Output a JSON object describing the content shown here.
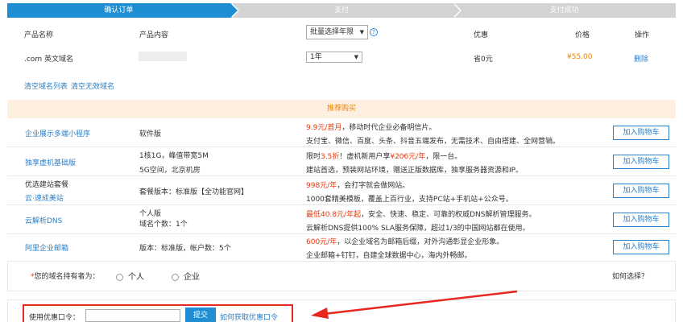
{
  "steps": [
    "确认订单",
    "支付",
    "支付成功"
  ],
  "product_table": {
    "headers": {
      "name": "产品名称",
      "content": "产品内容",
      "discount": "优惠",
      "price": "价格",
      "action": "操作"
    },
    "batch_year_select": "批量选择年限",
    "row": {
      "name": ".com 英文域名",
      "year": "1年",
      "discount": "省0元",
      "price": "¥55.00",
      "delete": "删除"
    }
  },
  "links": {
    "clear_list": "清空域名列表",
    "clear_invalid": "清空无效域名"
  },
  "recommend": {
    "title": "推荐购买",
    "add_to_cart": "加入购物车",
    "items": [
      {
        "name": "企业展示多端小程序",
        "content": [
          "软件版"
        ],
        "desc1_red": "9.9元/首月",
        "desc1_rest": "，移动时代企业必备明信片。",
        "desc2": "支付宝、微信、百度、头条、抖音五端发布，无需技术、自由搭建、全网营销。"
      },
      {
        "name": "独享虚机基础版",
        "content": [
          "1核1G，峰值带宽5M",
          "5G空间，北京机房"
        ],
        "desc1_pre": "限时",
        "desc1_red": "3.5折",
        "desc1_mid": "！虚机新用户享",
        "desc1_red2": "¥206元/年",
        "desc1_rest": "，限一台。",
        "desc2": "建站首选，预装网站环境，赠送正版数据库，独享服务器资源和IP。"
      },
      {
        "name": "优选建站套餐",
        "name2": "云·速成美站",
        "content": [
          "套餐版本：标准版【全功能官网】"
        ],
        "desc1_red": "998元/年",
        "desc1_rest": "，会打字就会做网站。",
        "desc2": "1000套精美模板，覆盖上百行业，支持PC站+手机站+公众号。"
      },
      {
        "name": "云解析DNS",
        "content": [
          "个人版",
          "域名个数：1个"
        ],
        "desc1_red": "最低40.8元/年起",
        "desc1_rest": "，安全、快速、稳定、可靠的权威DNS解析管理服务。",
        "desc2": "云解析DNS提供100% SLA服务保障，超过1/3的中国网站都在使用。"
      },
      {
        "name": "阿里企业邮箱",
        "content": [
          "版本：标准版，帐户数：5个"
        ],
        "desc1_red": "600元/年",
        "desc1_rest": "，以企业域名为邮箱后缀，对外沟通彰显企业形象。",
        "desc2": "企业邮箱+钉钉，自建全球数据中心，海内外畅邮。"
      }
    ]
  },
  "owner": {
    "asterisk": "*",
    "label": "您的域名持有者为：",
    "personal": "个人",
    "enterprise": "企业",
    "how": "如何选择？"
  },
  "coupon": {
    "label": "使用优惠口令：",
    "submit": "提交",
    "how_get": "如何获取优惠口令"
  },
  "colors": {
    "primary_blue": "#1f8ed3",
    "link_blue": "#2c7fc8",
    "orange": "#f08300",
    "red": "#e8380d",
    "annotation_red": "#e8281f"
  }
}
